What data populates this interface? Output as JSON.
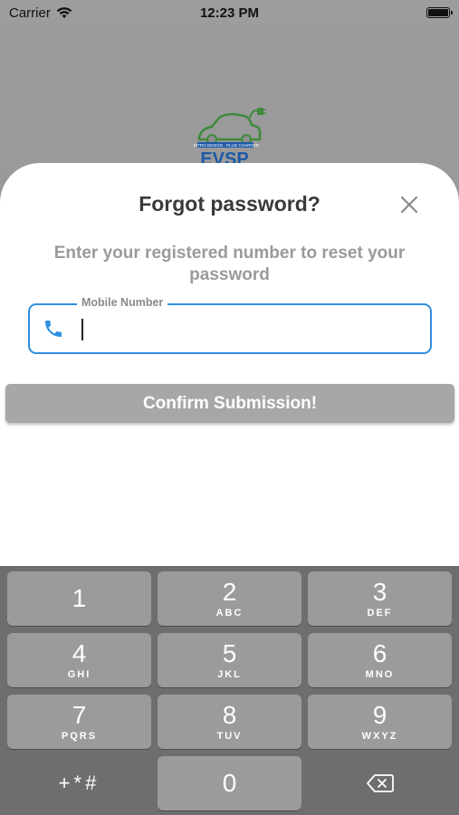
{
  "status_bar": {
    "carrier": "Carrier",
    "time": "12:23 PM"
  },
  "logo": {
    "tagline": "RETRO DESIGN - PLUG CHARGER",
    "brand": "EVSP"
  },
  "sheet": {
    "title": "Forgot password?",
    "subtitle": "Enter your registered number to reset your password",
    "field_label": "Mobile Number",
    "field_value": "",
    "confirm_label": "Confirm Submission!"
  },
  "keypad": {
    "keys": [
      {
        "num": "1",
        "letters": ""
      },
      {
        "num": "2",
        "letters": "ABC"
      },
      {
        "num": "3",
        "letters": "DEF"
      },
      {
        "num": "4",
        "letters": "GHI"
      },
      {
        "num": "5",
        "letters": "JKL"
      },
      {
        "num": "6",
        "letters": "MNO"
      },
      {
        "num": "7",
        "letters": "PQRS"
      },
      {
        "num": "8",
        "letters": "TUV"
      },
      {
        "num": "9",
        "letters": "WXYZ"
      },
      {
        "num": "0",
        "letters": ""
      }
    ],
    "symbols": "+*#"
  },
  "colors": {
    "accent": "#2f8fe0",
    "button_disabled": "#a7a7a7",
    "logo_green": "#3f8a3c",
    "logo_blue": "#1d5aa8"
  }
}
